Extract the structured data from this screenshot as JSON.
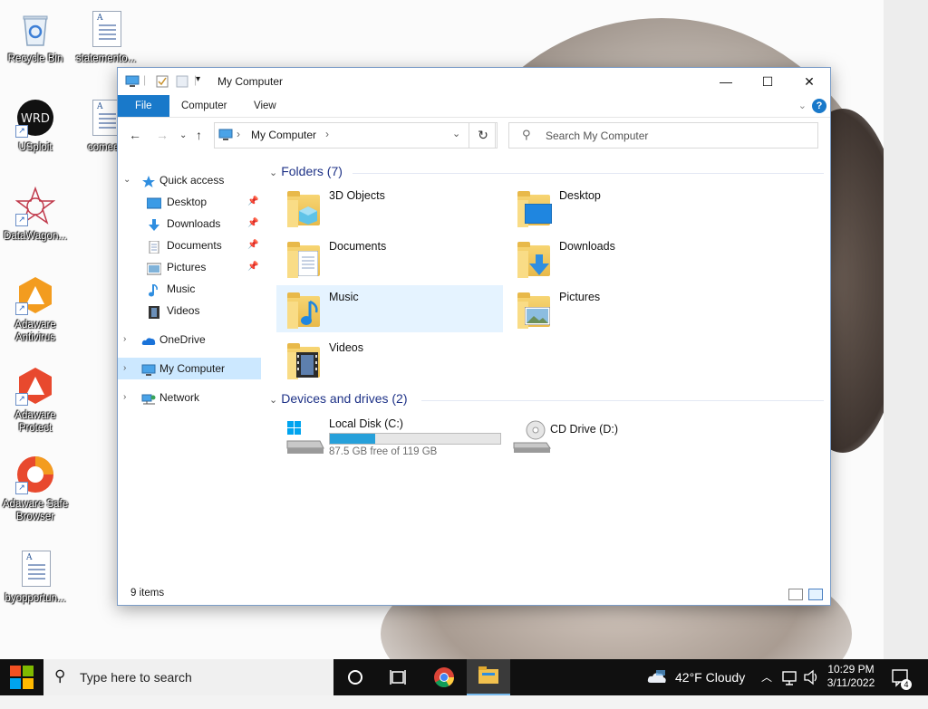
{
  "desktop": {
    "icons": [
      {
        "label": "Recycle Bin"
      },
      {
        "label": "statemento..."
      },
      {
        "label": "USploit"
      },
      {
        "label": "comeefi"
      },
      {
        "label": "DataWagon..."
      },
      {
        "label": "Adaware Antivirus"
      },
      {
        "label": "Adaware Protect"
      },
      {
        "label": "Adaware Safe Browser"
      },
      {
        "label": "byopportun..."
      }
    ]
  },
  "window": {
    "title": "My Computer",
    "controls": {
      "minimize": "—",
      "maximize": "☐",
      "close": "✕"
    },
    "ribbon_tabs": [
      "File",
      "Computer",
      "View"
    ],
    "help": "?",
    "address": {
      "location": "My Computer"
    },
    "search": {
      "placeholder": "Search My Computer"
    },
    "nav": {
      "quick_access": "Quick access",
      "quick_items": [
        {
          "label": "Desktop",
          "pinned": true
        },
        {
          "label": "Downloads",
          "pinned": true
        },
        {
          "label": "Documents",
          "pinned": true
        },
        {
          "label": "Pictures",
          "pinned": true
        },
        {
          "label": "Music",
          "pinned": false
        },
        {
          "label": "Videos",
          "pinned": false
        }
      ],
      "onedrive": "OneDrive",
      "my_computer": "My Computer",
      "network": "Network"
    },
    "folders_header": "Folders (7)",
    "folders": [
      "3D Objects",
      "Desktop",
      "Documents",
      "Downloads",
      "Music",
      "Pictures",
      "Videos"
    ],
    "devices_header": "Devices and drives (2)",
    "drives": [
      {
        "name": "Local Disk (C:)",
        "free_text": "87.5 GB free of 119 GB",
        "used_fraction": 0.265
      },
      {
        "name": "CD Drive (D:)"
      }
    ],
    "status": "9 items"
  },
  "taskbar": {
    "search_placeholder": "Type here to search",
    "weather": "42°F  Cloudy",
    "time": "10:29 PM",
    "date": "3/11/2022",
    "notifications": "4"
  },
  "colors": {
    "accent": "#1979ca",
    "selection": "#cce8ff",
    "drive_fill": "#26a0da"
  }
}
